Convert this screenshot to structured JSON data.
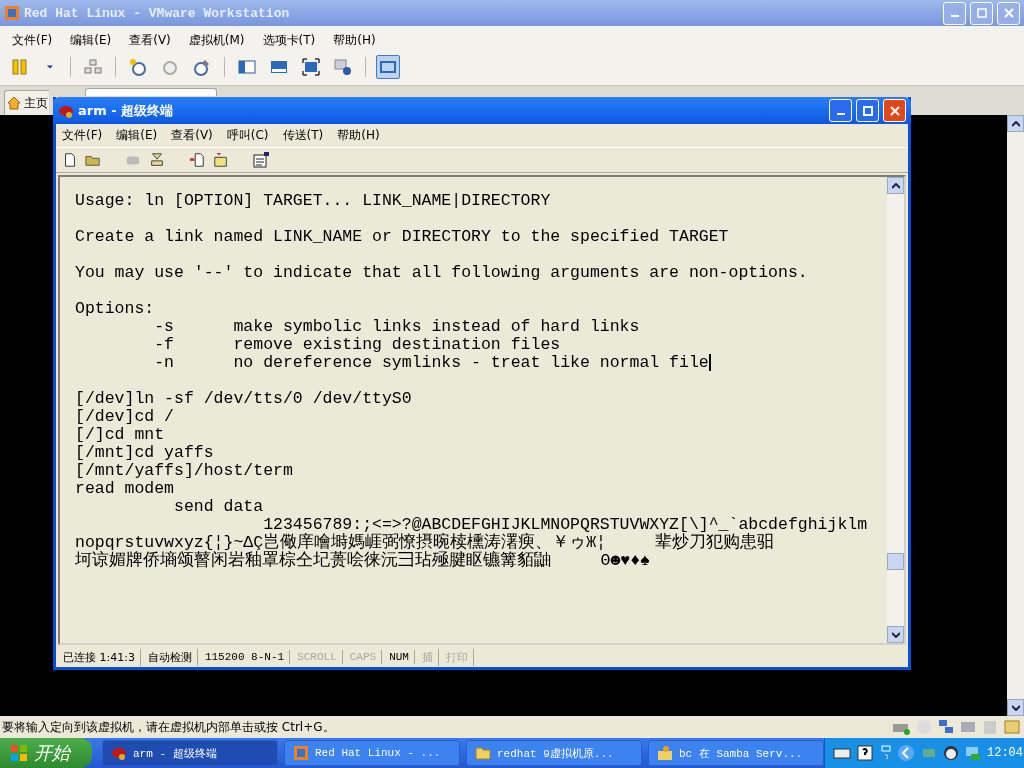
{
  "vmware_window": {
    "title": "Red Hat Linux - VMware Workstation",
    "menu": [
      "文件(F)",
      "编辑(E)",
      "查看(V)",
      "虚拟机(M)",
      "选项卡(T)",
      "帮助(H)"
    ],
    "toolbar": [
      [
        {
          "kind": "pause",
          "selected": false
        },
        {
          "kind": "dropdown",
          "selected": false
        }
      ],
      [
        {
          "kind": "network",
          "selected": false
        }
      ],
      [
        {
          "kind": "snapshot",
          "selected": false
        },
        {
          "kind": "revert",
          "selected": false
        },
        {
          "kind": "manager",
          "selected": false
        }
      ],
      [
        {
          "kind": "sidebar",
          "selected": false
        },
        {
          "kind": "bottombar",
          "selected": false
        },
        {
          "kind": "fullscreen",
          "selected": false
        },
        {
          "kind": "info",
          "selected": false
        }
      ],
      [
        {
          "kind": "console",
          "selected": true
        }
      ]
    ],
    "tabs": [
      {
        "label": "主页",
        "selected": false
      }
    ],
    "status_hint": "要将输入定向到该虚拟机，请在虚拟机内部单击或按 Ctrl+G。"
  },
  "terminal_window": {
    "title": "arm - 超级终端",
    "menu": [
      "文件(F)",
      "编辑(E)",
      "查看(V)",
      "呼叫(C)",
      "传送(T)",
      "帮助(H)"
    ],
    "toolbar": [
      [
        {
          "kind": "new"
        },
        {
          "kind": "open"
        }
      ],
      [
        {
          "kind": "phone"
        },
        {
          "kind": "hangup"
        }
      ],
      [
        {
          "kind": "send"
        },
        {
          "kind": "receive"
        }
      ],
      [
        {
          "kind": "properties"
        }
      ]
    ],
    "lines": [
      {
        "text": "Usage: ln [OPTION] TARGET... LINK_NAME|DIRECTORY",
        "space_before": false,
        "cursor": false
      },
      {
        "text": "Create a link named LINK_NAME or DIRECTORY to the specified TARGET",
        "space_before": true,
        "cursor": false
      },
      {
        "text": "You may use '--' to indicate that all following arguments are non-options.",
        "space_before": true,
        "cursor": false
      },
      {
        "text": "Options:",
        "space_before": true,
        "cursor": false
      },
      {
        "text": "        -s      make symbolic links instead of hard links",
        "space_before": false,
        "cursor": false
      },
      {
        "text": "        -f      remove existing destination files",
        "space_before": false,
        "cursor": false
      },
      {
        "text": "        -n      no dereference symlinks - treat like normal file",
        "space_before": false,
        "cursor": true
      },
      {
        "text": "[/dev]ln -sf /dev/tts/0 /dev/ttyS0",
        "space_before": true,
        "cursor": false
      },
      {
        "text": "[/dev]cd /",
        "space_before": false,
        "cursor": false
      },
      {
        "text": "[/]cd mnt",
        "space_before": false,
        "cursor": false
      },
      {
        "text": "[/mnt]cd yaffs",
        "space_before": false,
        "cursor": false
      },
      {
        "text": "[/mnt/yaffs]/host/term",
        "space_before": false,
        "cursor": false
      },
      {
        "text": "read modem",
        "space_before": false,
        "cursor": false
      },
      {
        "text": "          send data",
        "space_before": false,
        "cursor": false
      },
      {
        "text": "                   123456789:;<=>?@ABCDEFGHIJKLMNOPQRSTUVWXYZ[\\]^_`abcdefghijklm",
        "space_before": false,
        "cursor": false
      },
      {
        "text": "nopqrstuvwxyz{¦}~ΔÇ岂儆庠噲塒媽崕弼憭摂晼椟櫄涛濖瘐、￥ゥЖ¦     辈炒刀犯购患驲",
        "space_before": false,
        "cursor": false
      },
      {
        "text": "坷谅媚牌侨墒颂瞽闲岩釉罩棕仝圮蒉哙徕沅彐玷殛腱眍镳篝貊鼬     Θ☻♥♦♠",
        "space_before": false,
        "cursor": false
      }
    ],
    "status_panes": [
      {
        "text": "已连接 1:41:3",
        "enabled": true
      },
      {
        "text": "自动检测",
        "enabled": true
      },
      {
        "text": "115200 8-N-1",
        "enabled": true
      },
      {
        "text": "SCROLL",
        "enabled": false
      },
      {
        "text": "CAPS",
        "enabled": false
      },
      {
        "text": "NUM",
        "enabled": true
      },
      {
        "text": "捕",
        "enabled": false
      },
      {
        "text": "打印",
        "enabled": false
      }
    ]
  },
  "taskbar": {
    "start": "开始",
    "tasks": [
      {
        "label": "arm - 超级终端",
        "kind": "terminal",
        "selected": true
      },
      {
        "label": "Red Hat Linux - ...",
        "kind": "vmware",
        "selected": false
      },
      {
        "label": "redhat 9虚拟机原...",
        "kind": "folder",
        "selected": false
      },
      {
        "label": "bc 在 Samba Serv...",
        "kind": "samba",
        "selected": false
      }
    ],
    "clock": "12:04"
  }
}
